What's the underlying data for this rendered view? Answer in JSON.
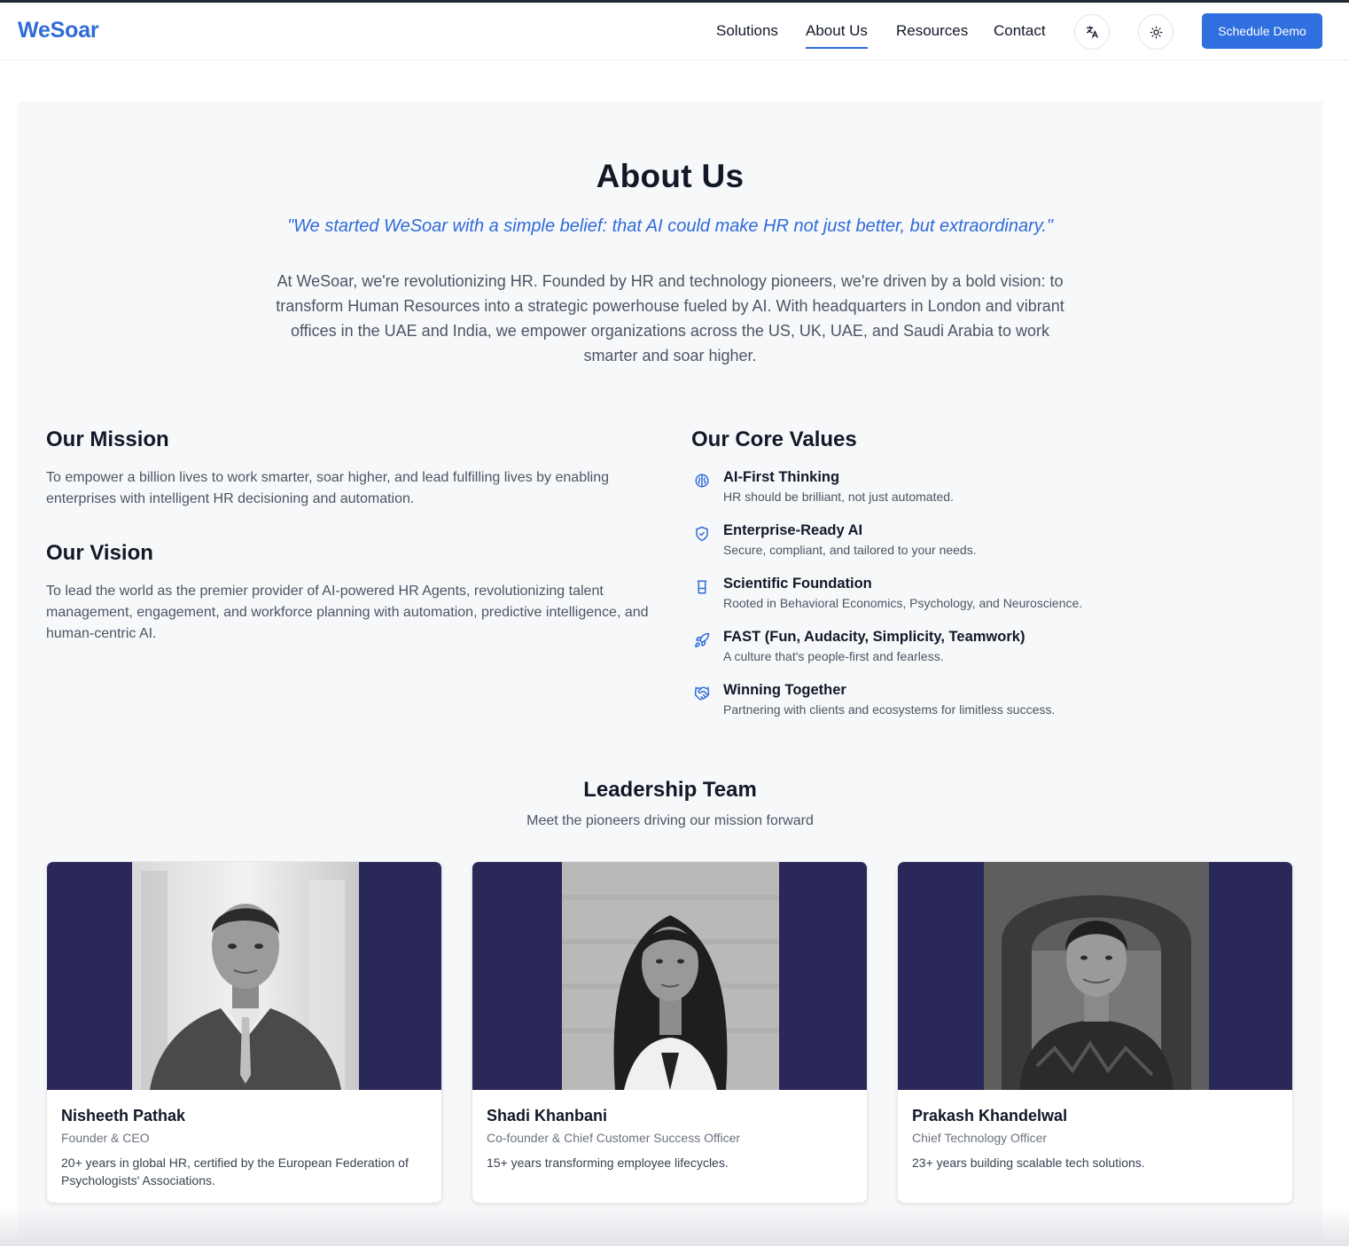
{
  "header": {
    "logo": "WeSoar",
    "nav": [
      "Solutions",
      "About Us",
      "Resources",
      "Contact"
    ],
    "active_nav": "About Us",
    "translate_icon": "translate-icon",
    "theme_icon": "sun-icon",
    "cta_label": "Schedule Demo"
  },
  "about": {
    "title": "About Us",
    "quote": "\"We started WeSoar with a simple belief: that AI could make HR not just better, but extraordinary.\"",
    "intro": "At WeSoar, we're revolutionizing HR. Founded by HR and technology pioneers, we're driven by a bold vision: to transform Human Resources into a strategic powerhouse fueled by AI. With headquarters in London and vibrant offices in the UAE and India, we empower organizations across the US, UK, UAE, and Saudi Arabia to work smarter and soar higher."
  },
  "mission": {
    "title": "Our Mission",
    "text": "To empower a billion lives to work smarter, soar higher, and lead fulfilling lives by enabling enterprises with intelligent HR decisioning and automation."
  },
  "vision": {
    "title": "Our Vision",
    "text": "To lead the world as the premier provider of AI-powered HR Agents, revolutionizing talent management, engagement, and workforce planning with automation, predictive intelligence, and human-centric AI."
  },
  "values": {
    "title": "Our Core Values",
    "items": [
      {
        "icon": "brain-icon",
        "title": "AI-First Thinking",
        "desc": "HR should be brilliant, not just automated."
      },
      {
        "icon": "shield-check-icon",
        "title": "Enterprise-Ready AI",
        "desc": "Secure, compliant, and tailored to your needs."
      },
      {
        "icon": "beaker-icon",
        "title": "Scientific Foundation",
        "desc": "Rooted in Behavioral Economics, Psychology, and Neuroscience."
      },
      {
        "icon": "rocket-icon",
        "title": "FAST (Fun, Audacity, Simplicity, Teamwork)",
        "desc": "A culture that's people-first and fearless."
      },
      {
        "icon": "handshake-icon",
        "title": "Winning Together",
        "desc": "Partnering with clients and ecosystems for limitless success."
      }
    ]
  },
  "team": {
    "title": "Leadership Team",
    "subtitle": "Meet the pioneers driving our mission forward",
    "members": [
      {
        "name": "Nisheeth Pathak",
        "role": "Founder & CEO",
        "bio": "20+ years in global HR, certified by the European Federation of Psychologists' Associations."
      },
      {
        "name": "Shadi Khanbani",
        "role": "Co-founder & Chief Customer Success Officer",
        "bio": "15+ years transforming employee lifecycles."
      },
      {
        "name": "Prakash Khandelwal",
        "role": "Chief Technology Officer",
        "bio": "23+ years building scalable tech solutions."
      }
    ]
  },
  "colors": {
    "accent": "#2f6bd8",
    "button": "#2f6fe0",
    "card_photo_bg": "#2a2858",
    "panel_bg": "#f7f8fa"
  }
}
